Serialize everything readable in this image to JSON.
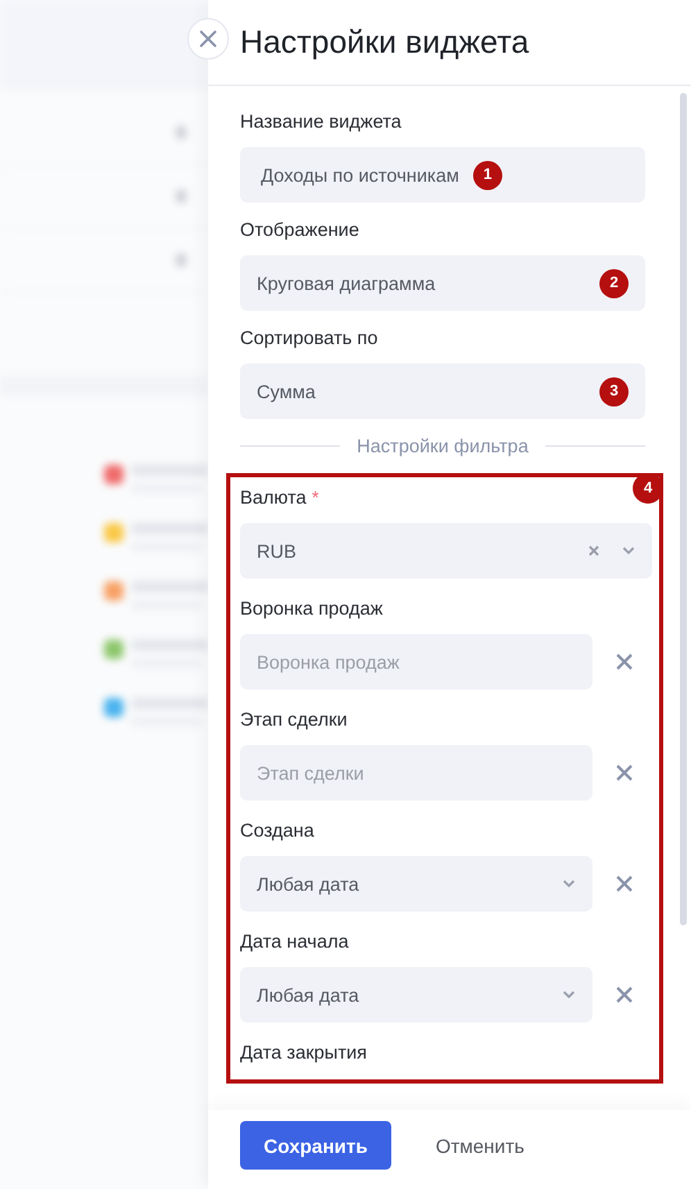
{
  "background_legend": [
    {
      "color": "#f06a6a"
    },
    {
      "color": "#f9c846"
    },
    {
      "color": "#f7a064"
    },
    {
      "color": "#8cc66b"
    },
    {
      "color": "#4ab3ee"
    }
  ],
  "panel": {
    "title": "Настройки виджета"
  },
  "main_fields": [
    {
      "label": "Название виджета",
      "value": "Доходы по источникам",
      "marker": "1"
    },
    {
      "label": "Отображение",
      "value": "Круговая диаграмма",
      "marker": "2"
    },
    {
      "label": "Сортировать по",
      "value": "Сумма",
      "marker": "3"
    }
  ],
  "filter_section": {
    "title": "Настройки фильтра",
    "marker": "4",
    "fields": [
      {
        "label": "Валюта",
        "required_mark": "*",
        "kind": "select",
        "value": "RUB",
        "clearable": true,
        "removable": false
      },
      {
        "label": "Воронка продаж",
        "kind": "input",
        "placeholder": "Воронка продаж",
        "removable": true
      },
      {
        "label": "Этап сделки",
        "kind": "input",
        "placeholder": "Этап сделки",
        "removable": true
      },
      {
        "label": "Создана",
        "kind": "select",
        "value": "Любая дата",
        "clearable": false,
        "removable": true
      },
      {
        "label": "Дата начала",
        "kind": "select",
        "value": "Любая дата",
        "clearable": false,
        "removable": true
      },
      {
        "label": "Дата закрытия",
        "kind": "label_only"
      }
    ]
  },
  "footer": {
    "save": "Сохранить",
    "cancel": "Отменить"
  }
}
